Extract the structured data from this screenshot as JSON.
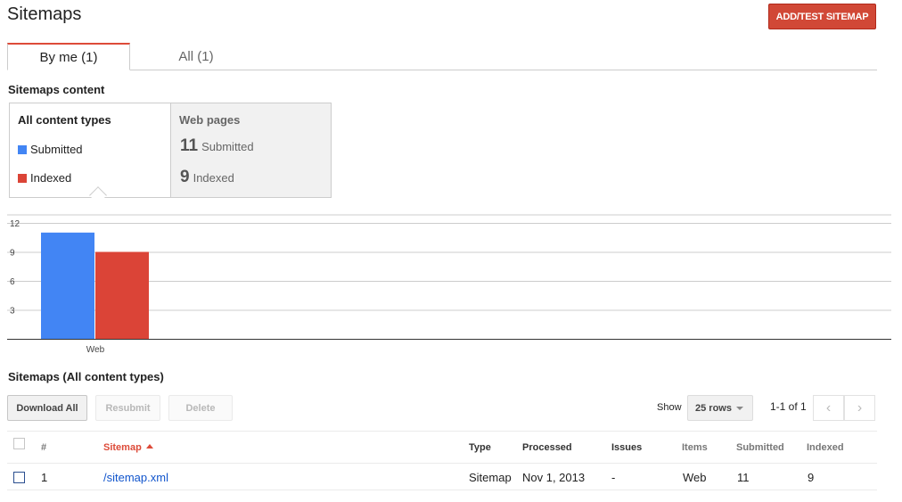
{
  "header": {
    "title": "Sitemaps",
    "add_button": "ADD/TEST SITEMAP"
  },
  "tabs": [
    {
      "label": "By me (1)",
      "active": true
    },
    {
      "label": "All (1)",
      "active": false
    }
  ],
  "content_section": {
    "title": "Sitemaps content",
    "left": {
      "heading": "All content types",
      "legend": [
        {
          "label": "Submitted",
          "color": "#4285f4"
        },
        {
          "label": "Indexed",
          "color": "#db4437"
        }
      ]
    },
    "right": {
      "heading": "Web pages",
      "submitted_count": "11",
      "submitted_label": "Submitted",
      "indexed_count": "9",
      "indexed_label": "Indexed"
    }
  },
  "chart_data": {
    "type": "bar",
    "categories": [
      "Web"
    ],
    "series": [
      {
        "name": "Submitted",
        "values": [
          11
        ],
        "color": "#4285f4"
      },
      {
        "name": "Indexed",
        "values": [
          9
        ],
        "color": "#db4437"
      }
    ],
    "yticks": [
      3,
      6,
      9,
      12
    ],
    "ylim": [
      0,
      12
    ],
    "grid": true
  },
  "list_section": {
    "title": "Sitemaps (All content types)",
    "buttons": {
      "download_all": "Download All",
      "resubmit": "Resubmit",
      "delete": "Delete"
    },
    "show_label": "Show",
    "rows_select": "25 rows",
    "page_range": "1-1 of 1",
    "prev_icon": "‹",
    "next_icon": "›"
  },
  "table": {
    "columns": {
      "num": "#",
      "sitemap": "Sitemap",
      "type": "Type",
      "processed": "Processed",
      "issues": "Issues",
      "items": "Items",
      "submitted": "Submitted",
      "indexed": "Indexed"
    },
    "rows": [
      {
        "num": "1",
        "sitemap": "/sitemap.xml",
        "type": "Sitemap",
        "processed": "Nov 1, 2013",
        "issues": "-",
        "items": "Web",
        "submitted": "11",
        "indexed": "9"
      }
    ]
  }
}
